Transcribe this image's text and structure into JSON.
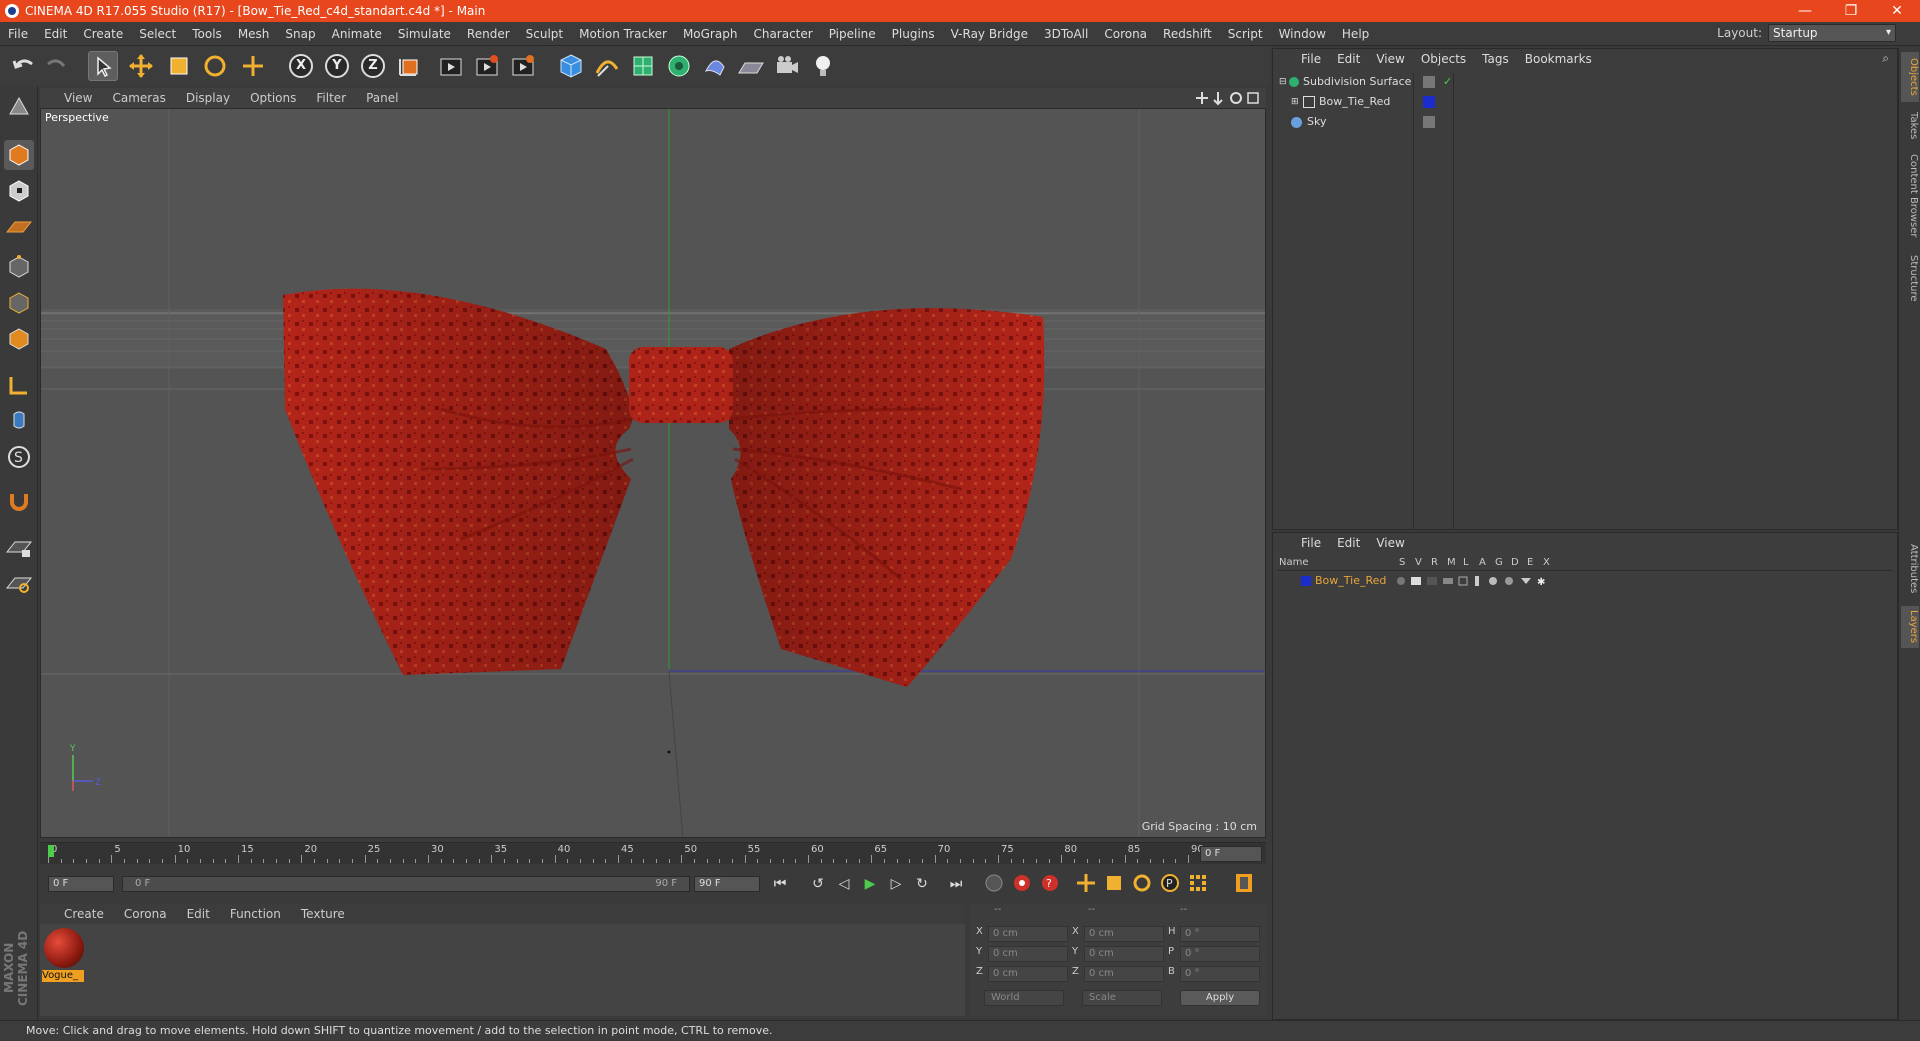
{
  "window": {
    "title": "CINEMA 4D R17.055 Studio (R17) - [Bow_Tie_Red_c4d_standart.c4d *] - Main",
    "controls": {
      "minimize": "—",
      "restore": "❐",
      "close": "✕"
    }
  },
  "menubar": {
    "items": [
      "File",
      "Edit",
      "Create",
      "Select",
      "Tools",
      "Mesh",
      "Snap",
      "Animate",
      "Simulate",
      "Render",
      "Sculpt",
      "Motion Tracker",
      "MoGraph",
      "Character",
      "Pipeline",
      "Plugins",
      "V-Ray Bridge",
      "3DToAll",
      "Corona",
      "Redshift",
      "Script",
      "Window",
      "Help"
    ],
    "layout_label": "Layout:",
    "layout_value": "Startup"
  },
  "toolbar": {
    "axis_x": "X",
    "axis_y": "Y",
    "axis_z": "Z"
  },
  "viewport": {
    "menu": [
      "View",
      "Cameras",
      "Display",
      "Options",
      "Filter",
      "Panel"
    ],
    "camera_label": "Perspective",
    "grid_spacing": "Grid Spacing : 10 cm"
  },
  "timeline": {
    "ticks": [
      "0",
      "5",
      "10",
      "15",
      "20",
      "25",
      "30",
      "35",
      "40",
      "45",
      "50",
      "55",
      "60",
      "65",
      "70",
      "75",
      "80",
      "85",
      "90"
    ],
    "current_frame_field": "0 F",
    "start_field": "0 F",
    "range_start": "0 F",
    "range_end": "90 F",
    "end_field": "90 F"
  },
  "material_panel": {
    "menu": [
      "Create",
      "Corona",
      "Edit",
      "Function",
      "Texture"
    ],
    "material_name": "Vogue_"
  },
  "coords": {
    "header": [
      "--",
      "--",
      "--"
    ],
    "rows": [
      {
        "a_label": "X",
        "a_val": "0 cm",
        "b_label": "X",
        "b_val": "0 cm",
        "c_label": "H",
        "c_val": "0 °"
      },
      {
        "a_label": "Y",
        "a_val": "0 cm",
        "b_label": "Y",
        "b_val": "0 cm",
        "c_label": "P",
        "c_val": "0 °"
      },
      {
        "a_label": "Z",
        "a_val": "0 cm",
        "b_label": "Z",
        "b_val": "0 cm",
        "c_label": "B",
        "c_val": "0 °"
      }
    ],
    "world": "World",
    "scale": "Scale",
    "apply": "Apply"
  },
  "object_manager": {
    "menu": [
      "File",
      "Edit",
      "View",
      "Objects",
      "Tags",
      "Bookmarks"
    ],
    "objects": [
      "Subdivision Surface",
      "Bow_Tie_Red",
      "Sky"
    ]
  },
  "layer_manager": {
    "menu": [
      "File",
      "Edit",
      "View"
    ],
    "columns": [
      "Name",
      "S",
      "V",
      "R",
      "M",
      "L",
      "A",
      "G",
      "D",
      "E",
      "X"
    ],
    "layers": [
      "Bow_Tie_Red"
    ]
  },
  "side_tabs": [
    "Objects",
    "Takes",
    "Content Browser",
    "Structure",
    "Attributes",
    "Layers"
  ],
  "status": "Move: Click and drag to move elements. Hold down SHIFT to quantize movement / add to the selection in point mode, CTRL to remove.",
  "branding": "MAXON CINEMA 4D",
  "colors": {
    "title_bar": "#e8461c",
    "bow_red": "#c8291c",
    "accent_orange": "#e8a53a",
    "layer_blue": "#1a2ccc"
  }
}
